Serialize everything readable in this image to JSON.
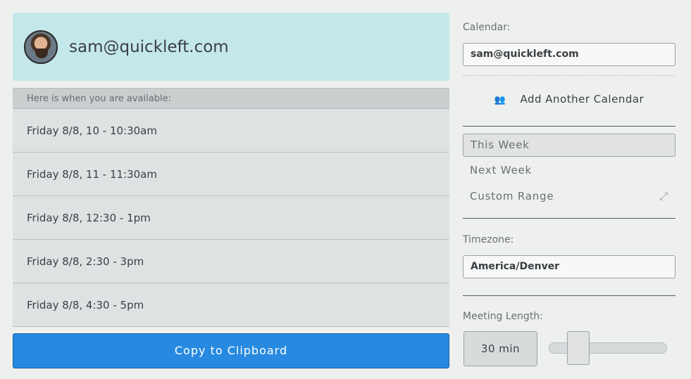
{
  "profile": {
    "email": "sam@quickleft.com"
  },
  "availability": {
    "header": "Here is when you are available:",
    "slots": [
      "Friday 8/8, 10 - 10:30am",
      "Friday 8/8, 11 - 11:30am",
      "Friday 8/8, 12:30 - 1pm",
      "Friday 8/8, 2:30 - 3pm",
      "Friday 8/8, 4:30 - 5pm"
    ]
  },
  "copy_button": {
    "label": "Copy to Clipboard"
  },
  "sidebar": {
    "calendar_label": "Calendar:",
    "calendar_value": "sam@quickleft.com",
    "add_calendar_label": "Add Another Calendar",
    "add_calendar_icon": "users-icon",
    "ranges": [
      {
        "label": "This Week",
        "active": true
      },
      {
        "label": "Next Week",
        "active": false
      },
      {
        "label": "Custom Range",
        "active": false
      }
    ],
    "expand_icon": "expand-icon",
    "timezone_label": "Timezone:",
    "timezone_value": "America/Denver",
    "meeting_length_label": "Meeting Length:",
    "meeting_length_value": "30 min",
    "meeting_length_slider_fraction": 0.19
  },
  "colors": {
    "background": "#eef0ee",
    "profile_bg": "#c4e8ea",
    "button_blue": "#278ae0"
  }
}
